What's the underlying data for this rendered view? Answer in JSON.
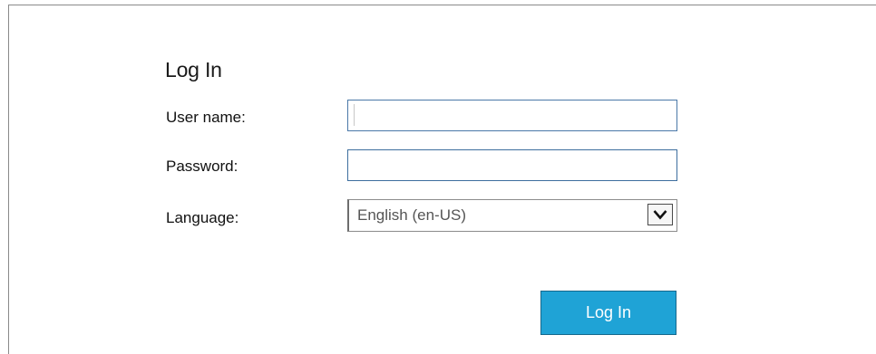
{
  "login": {
    "title": "Log In",
    "username_label": "User name:",
    "username_value": "",
    "password_label": "Password:",
    "password_value": "",
    "language_label": "Language:",
    "language_selected": "English (en-US)",
    "submit_label": "Log In"
  },
  "icons": {
    "dropdown": "chevron-down-icon"
  },
  "colors": {
    "button_bg": "#1fa3d6",
    "input_border": "#4a78a8"
  }
}
